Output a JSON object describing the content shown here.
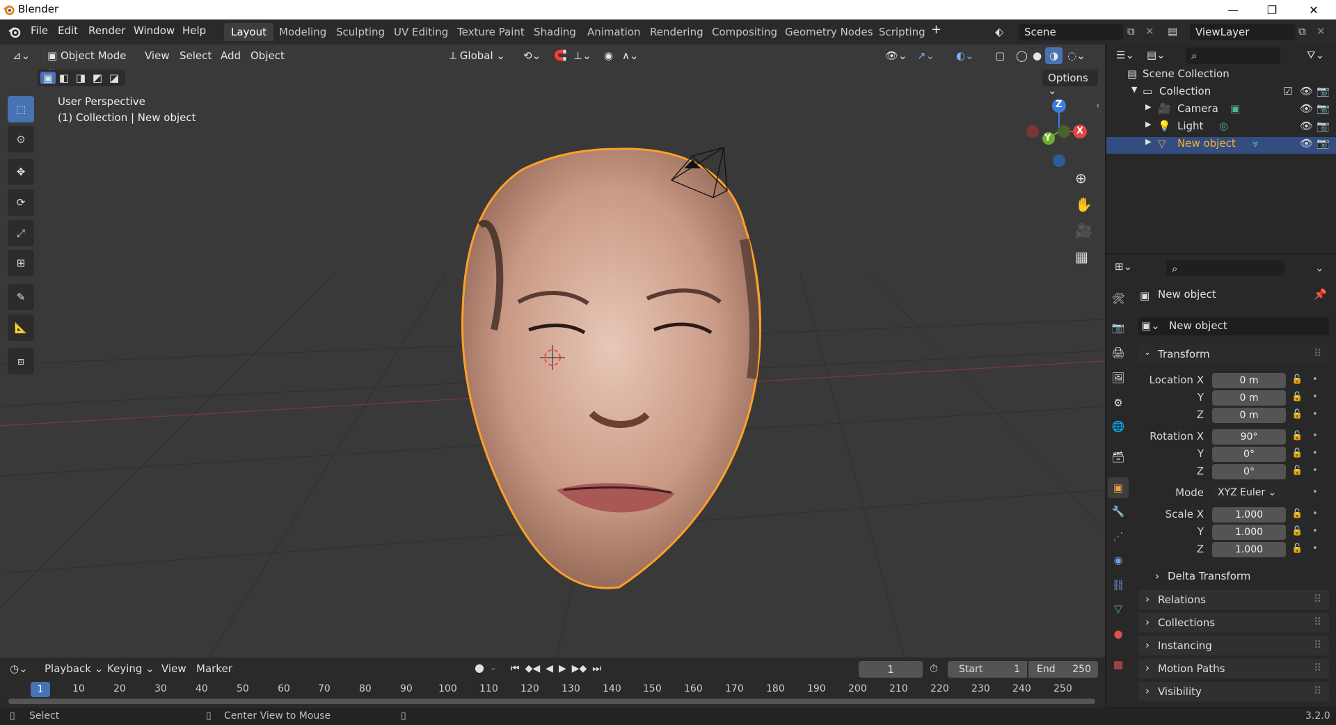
{
  "app": {
    "title": "Blender",
    "version": "3.2.0"
  },
  "menu": [
    "File",
    "Edit",
    "Render",
    "Window",
    "Help"
  ],
  "workspaces": [
    "Layout",
    "Modeling",
    "Sculpting",
    "UV Editing",
    "Texture Paint",
    "Shading",
    "Animation",
    "Rendering",
    "Compositing",
    "Geometry Nodes",
    "Scripting"
  ],
  "scene": "Scene",
  "view_layer": "ViewLayer",
  "viewport": {
    "mode": "Object Mode",
    "menus": [
      "View",
      "Select",
      "Add",
      "Object"
    ],
    "orientation": "Global",
    "options": "Options",
    "perspective": "User Perspective",
    "context": "(1) Collection | New object",
    "gizmo": {
      "z": "Z",
      "y": "Y",
      "x": "X"
    }
  },
  "outliner": {
    "root": "Scene Collection",
    "collection": "Collection",
    "items": [
      "Camera",
      "Light",
      "New object"
    ]
  },
  "properties": {
    "object_name": "New object",
    "data_name": "New object",
    "transform_title": "Transform",
    "location": {
      "label": "Location X",
      "x": "0 m",
      "y": "0 m",
      "z": "0 m"
    },
    "rotation": {
      "label": "Rotation X",
      "x": "90°",
      "y": "0°",
      "z": "0°"
    },
    "mode_label": "Mode",
    "mode_value": "XYZ Euler",
    "scale": {
      "label": "Scale X",
      "x": "1.000",
      "y": "1.000",
      "z": "1.000"
    },
    "axis_y": "Y",
    "axis_z": "Z",
    "subpanels": [
      "Delta Transform",
      "Relations",
      "Collections",
      "Instancing",
      "Motion Paths",
      "Visibility"
    ]
  },
  "timeline": {
    "menus": [
      "Playback",
      "Keying",
      "View",
      "Marker"
    ],
    "current_frame": "1",
    "start_label": "Start",
    "start": "1",
    "end_label": "End",
    "end": "250",
    "ticks": [
      "1",
      "10",
      "20",
      "30",
      "40",
      "50",
      "60",
      "70",
      "80",
      "90",
      "100",
      "110",
      "120",
      "130",
      "140",
      "150",
      "160",
      "170",
      "180",
      "190",
      "200",
      "210",
      "220",
      "230",
      "240",
      "250"
    ]
  },
  "status": {
    "left": "Select",
    "middle": "Center View to Mouse"
  },
  "colors": {
    "accent": "#4772b3",
    "selection": "#ffa028",
    "bg": "#393939"
  }
}
